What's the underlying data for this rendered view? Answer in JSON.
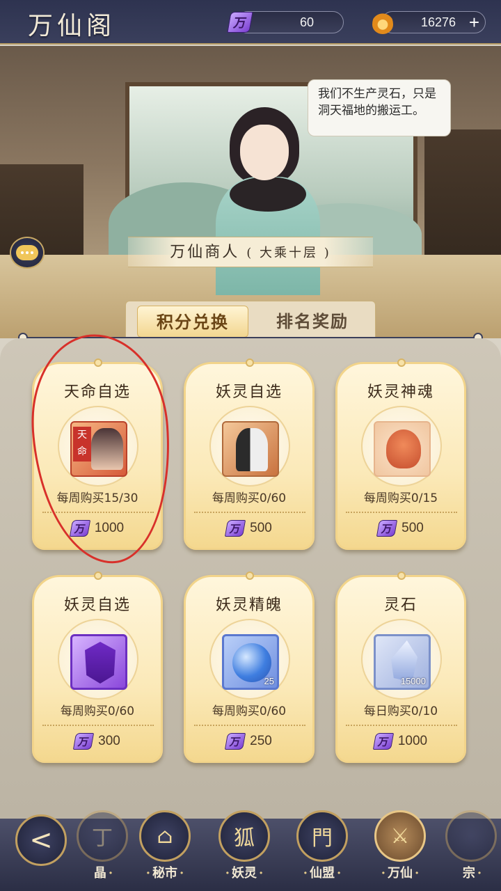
{
  "header": {
    "title": "万仙阁",
    "points": {
      "icon": "万",
      "value": "60"
    },
    "spirit_stones": {
      "value": "16276",
      "add_symbol": "+"
    }
  },
  "scene": {
    "speech": "我们不生产灵石，只是洞天福地的搬运工。",
    "merchant_name": "万仙商人",
    "merchant_rank": "( 大乘十层 )"
  },
  "tabs": [
    {
      "label": "积分兑换",
      "active": true
    },
    {
      "label": "排名奖励",
      "active": false
    }
  ],
  "items": [
    {
      "name": "天命自选",
      "icon": "tianming-portrait-icon",
      "tag": "天命",
      "limit": "每周购买15/30",
      "price": "1000",
      "qty": ""
    },
    {
      "name": "妖灵自选",
      "icon": "yaoling-portrait-icon",
      "limit": "每周购买0/60",
      "price": "500",
      "qty": ""
    },
    {
      "name": "妖灵神魂",
      "icon": "spirit-fox-icon",
      "limit": "每周购买0/15",
      "price": "500",
      "qty": ""
    },
    {
      "name": "妖灵自选",
      "icon": "purple-crystal-icon",
      "limit": "每周购买0/60",
      "price": "300",
      "qty": ""
    },
    {
      "name": "妖灵精魄",
      "icon": "blue-orb-icon",
      "limit": "每周购买0/60",
      "price": "250",
      "qty": "25"
    },
    {
      "name": "灵石",
      "icon": "spirit-stone-icon",
      "limit": "每日购买0/10",
      "price": "1000",
      "qty": "15000"
    }
  ],
  "price_icon": "万",
  "bottom_nav": {
    "back_icon": "back-arrow-icon",
    "items": [
      {
        "label": "晶",
        "glyph": "丁"
      },
      {
        "label": "秘市",
        "glyph": "⌂"
      },
      {
        "label": "妖灵",
        "glyph": "狐"
      },
      {
        "label": "仙盟",
        "glyph": "門"
      },
      {
        "label": "万仙",
        "glyph": "⚔"
      },
      {
        "label": "宗",
        "glyph": ""
      }
    ]
  },
  "colors": {
    "accent_gold": "#f2d48a",
    "header_navy": "#2e3350",
    "annotation_red": "#d8302a"
  }
}
